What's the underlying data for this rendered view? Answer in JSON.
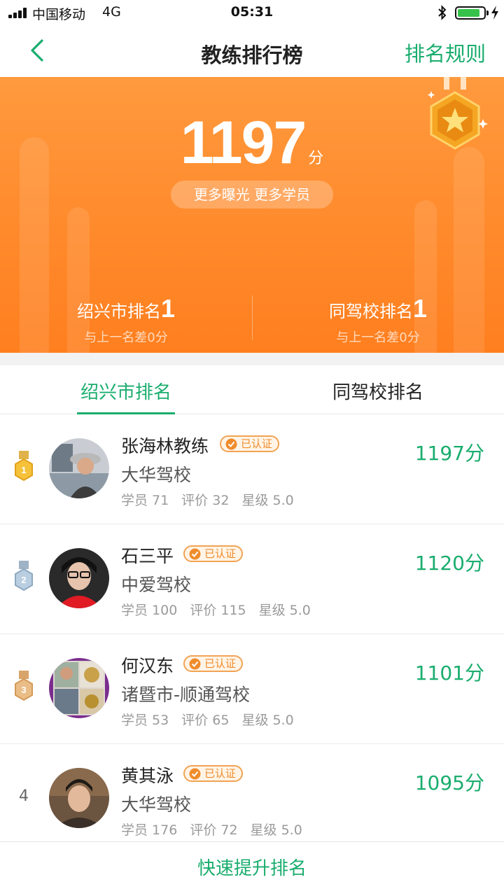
{
  "status_bar": {
    "carrier": "中国移动",
    "network": "4G",
    "time": "05:31",
    "battery_percent": 85
  },
  "nav": {
    "title": "教练排行榜",
    "rules_label": "排名规则"
  },
  "hero": {
    "score": "1197",
    "score_unit": "分",
    "slogan": "更多曝光  更多学员",
    "city_rank": {
      "label": "绍兴市排名",
      "value": "1",
      "diff": "与上一名差0分"
    },
    "school_rank": {
      "label": "同驾校排名",
      "value": "1",
      "diff": "与上一名差0分"
    }
  },
  "tabs": [
    {
      "label": "绍兴市排名",
      "active": true
    },
    {
      "label": "同驾校排名",
      "active": false
    }
  ],
  "coaches": [
    {
      "rank": "1",
      "name": "张海林教练",
      "badge": "已认证",
      "school": "大华驾校",
      "students": "学员 71",
      "reviews": "评价 32",
      "stars": "星级 5.0",
      "points": "1197分",
      "medal": "gold"
    },
    {
      "rank": "2",
      "name": "石三平",
      "badge": "已认证",
      "school": "中爱驾校",
      "students": "学员 100",
      "reviews": "评价 115",
      "stars": "星级 5.0",
      "points": "1120分",
      "medal": "silver"
    },
    {
      "rank": "3",
      "name": "何汉东",
      "badge": "已认证",
      "school": "诸暨市-顺通驾校",
      "students": "学员 53",
      "reviews": "评价 65",
      "stars": "星级 5.0",
      "points": "1101分",
      "medal": "bronze"
    },
    {
      "rank": "4",
      "name": "黄其泳",
      "badge": "已认证",
      "school": "大华驾校",
      "students": "学员 176",
      "reviews": "评价 72",
      "stars": "星级 5.0",
      "points": "1095分",
      "medal": "none"
    }
  ],
  "bottom_action": "快速提升排名",
  "colors": {
    "accent": "#1aad6e",
    "hero_orange": "#ff8a2c",
    "badge_orange": "#f08c2c",
    "gold": "#f5b82e",
    "silver": "#a9c3d9",
    "bronze": "#e7b67a"
  },
  "icons": [
    "back-chevron-icon",
    "medal-star-icon",
    "verified-check-icon",
    "rank-medal-icon",
    "bluetooth-icon",
    "battery-icon",
    "signal-icon",
    "charging-icon"
  ]
}
